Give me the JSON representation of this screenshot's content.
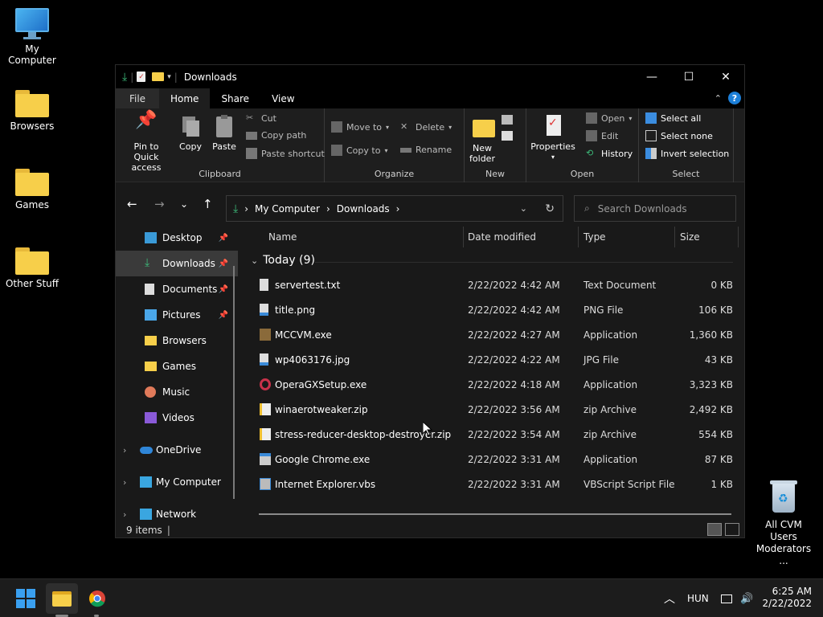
{
  "desktop": {
    "icons": [
      {
        "label": "My Computer"
      },
      {
        "label": "Browsers"
      },
      {
        "label": "Games"
      },
      {
        "label": "Other Stuff"
      }
    ],
    "recycle_bin": {
      "line1": "All CVM Users",
      "line2": "Moderators ..."
    }
  },
  "window": {
    "title": "Downloads",
    "controls": {
      "minimize": "—",
      "maximize": "☐",
      "close": "✕"
    },
    "tabs": {
      "file": "File",
      "home": "Home",
      "share": "Share",
      "view": "View"
    },
    "ribbon": {
      "clipboard": {
        "name": "Clipboard",
        "pin_line1": "Pin to Quick",
        "pin_line2": "access",
        "copy": "Copy",
        "paste": "Paste",
        "cut": "Cut",
        "copy_path": "Copy path",
        "paste_shortcut": "Paste shortcut"
      },
      "organize": {
        "name": "Organize",
        "move_to": "Move to",
        "copy_to": "Copy to",
        "delete": "Delete",
        "rename": "Rename"
      },
      "new": {
        "name": "New",
        "new_folder_line1": "New",
        "new_folder_line2": "folder"
      },
      "open": {
        "name": "Open",
        "properties": "Properties",
        "open": "Open",
        "edit": "Edit",
        "history": "History"
      },
      "select": {
        "name": "Select",
        "select_all": "Select all",
        "select_none": "Select none",
        "invert": "Invert selection"
      }
    },
    "address": {
      "crumb1": "My Computer",
      "crumb2": "Downloads",
      "sep": "›"
    },
    "search": {
      "placeholder": "Search Downloads"
    },
    "sidebar": [
      {
        "label": "Desktop",
        "pinned": true
      },
      {
        "label": "Downloads",
        "pinned": true
      },
      {
        "label": "Documents",
        "pinned": true
      },
      {
        "label": "Pictures",
        "pinned": true
      },
      {
        "label": "Browsers"
      },
      {
        "label": "Games"
      },
      {
        "label": "Music"
      },
      {
        "label": "Videos"
      },
      {
        "label": "OneDrive"
      },
      {
        "label": "My Computer"
      },
      {
        "label": "Network"
      }
    ],
    "columns": {
      "name": "Name",
      "date": "Date modified",
      "type": "Type",
      "size": "Size"
    },
    "group": {
      "label": "Today (9)"
    },
    "files": [
      {
        "name": "servertest.txt",
        "date": "2/22/2022 4:42 AM",
        "type": "Text Document",
        "size": "0 KB"
      },
      {
        "name": "title.png",
        "date": "2/22/2022 4:42 AM",
        "type": "PNG File",
        "size": "106 KB"
      },
      {
        "name": "MCCVM.exe",
        "date": "2/22/2022 4:27 AM",
        "type": "Application",
        "size": "1,360 KB"
      },
      {
        "name": "wp4063176.jpg",
        "date": "2/22/2022 4:22 AM",
        "type": "JPG File",
        "size": "43 KB"
      },
      {
        "name": "OperaGXSetup.exe",
        "date": "2/22/2022 4:18 AM",
        "type": "Application",
        "size": "3,323 KB"
      },
      {
        "name": "winaerotweaker.zip",
        "date": "2/22/2022 3:56 AM",
        "type": "zip Archive",
        "size": "2,492 KB"
      },
      {
        "name": "stress-reducer-desktop-destroyer.zip",
        "date": "2/22/2022 3:54 AM",
        "type": "zip Archive",
        "size": "554 KB"
      },
      {
        "name": "Google Chrome.exe",
        "date": "2/22/2022 3:31 AM",
        "type": "Application",
        "size": "87 KB"
      },
      {
        "name": "Internet Explorer.vbs",
        "date": "2/22/2022 3:31 AM",
        "type": "VBScript Script File",
        "size": "1 KB"
      }
    ],
    "status": {
      "items": "9 items"
    }
  },
  "taskbar": {
    "language": "HUN",
    "time": "6:25 AM",
    "date": "2/22/2022"
  },
  "colors": {
    "accent": "#1c7fd8",
    "folder": "#f7cf4a",
    "download_green": "#3dbb7a"
  }
}
